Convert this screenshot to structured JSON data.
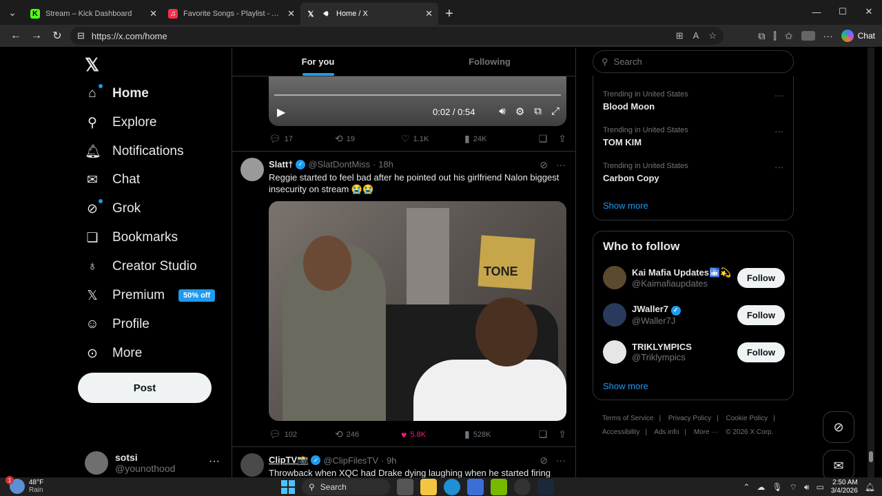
{
  "browser": {
    "tabs": [
      {
        "title": "Stream – Kick Dashboard",
        "favicon": "kick-icon",
        "color": "#53fc18"
      },
      {
        "title": "Favorite Songs - Playlist - Apple Music",
        "favicon": "apple-music-icon",
        "color": "#fa2d48"
      },
      {
        "title": "Home / X",
        "favicon": "x-icon",
        "color": "#ffffff"
      }
    ],
    "url": "https://x.com/home",
    "copilot_label": "Chat"
  },
  "sidebar": {
    "items": [
      {
        "label": "Home",
        "icon": "home-icon",
        "glyph": "⌂"
      },
      {
        "label": "Explore",
        "icon": "search-icon",
        "glyph": "⚲"
      },
      {
        "label": "Notifications",
        "icon": "bell-icon",
        "glyph": "🔔︎"
      },
      {
        "label": "Chat",
        "icon": "mail-icon",
        "glyph": "✉"
      },
      {
        "label": "Grok",
        "icon": "grok-icon",
        "glyph": "⊘"
      },
      {
        "label": "Bookmarks",
        "icon": "bookmark-icon",
        "glyph": "❏"
      },
      {
        "label": "Creator Studio",
        "icon": "flask-icon",
        "glyph": "♁"
      },
      {
        "label": "Premium",
        "icon": "x-icon",
        "glyph": "𝕏"
      },
      {
        "label": "Profile",
        "icon": "person-icon",
        "glyph": "☺"
      },
      {
        "label": "More",
        "icon": "more-circle-icon",
        "glyph": "⊙"
      }
    ],
    "premium_badge": "50% off",
    "post_label": "Post",
    "account": {
      "name": "sotsi",
      "handle": "@younothood"
    }
  },
  "feed": {
    "tabs": [
      "For you",
      "Following"
    ],
    "video": {
      "time": "0:02 / 0:54"
    },
    "tweet1_stats": {
      "replies": "17",
      "reposts": "19",
      "likes": "1.1K",
      "views": "24K"
    },
    "tweet2": {
      "name": "Slatt†",
      "handle": "@SlatDontMiss",
      "time": "· 18h",
      "text": "Reggie started to feel bad after he pointed out his girlfriend Nalon biggest insecurity on stream 😭😭",
      "image_text": "TONE",
      "stats": {
        "replies": "102",
        "reposts": "246",
        "likes": "5.8K",
        "views": "528K"
      }
    },
    "tweet3": {
      "name": "ClipTV📸",
      "handle": "@ClipFilesTV",
      "time": "· 9h",
      "text": "Throwback when XQC had Drake dying laughing when he started firing"
    }
  },
  "right": {
    "search_placeholder": "Search",
    "trends": [
      {
        "context": "Trending in United States",
        "title": "Blood Moon"
      },
      {
        "context": "Trending in United States",
        "title": "TOM KIM"
      },
      {
        "context": "Trending in United States",
        "title": "Carbon Copy"
      }
    ],
    "show_more": "Show more",
    "who_to_follow_title": "Who to follow",
    "who_to_follow": [
      {
        "name": "Kai Mafia Updates🛅💫",
        "handle": "@Kaimafiaupdates",
        "verified": false
      },
      {
        "name": "JWaller7",
        "handle": "@Waller7J",
        "verified": true
      },
      {
        "name": "TRIKLYMPICS",
        "handle": "@Triklympics",
        "verified": false
      }
    ],
    "follow_label": "Follow",
    "footer": [
      "Terms of Service",
      "|",
      "Privacy Policy",
      "|",
      "Cookie Policy",
      "|",
      "Accessibility",
      "|",
      "Ads info",
      "|",
      "More ···",
      "© 2026 X Corp."
    ]
  },
  "taskbar": {
    "weather_temp": "48°F",
    "weather_desc": "Rain",
    "weather_badge": "1",
    "search_label": "Search",
    "time": "2:50 AM",
    "date": "3/4/2026"
  }
}
